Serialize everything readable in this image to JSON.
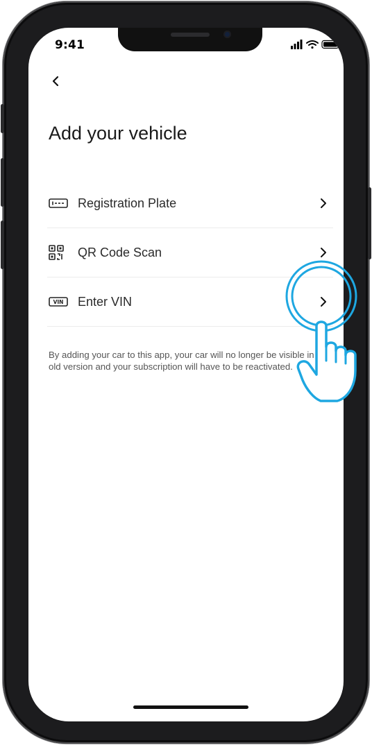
{
  "status_bar": {
    "time": "9:41"
  },
  "header": {
    "back_icon": "chevron-left-icon"
  },
  "page": {
    "title": "Add your vehicle"
  },
  "options": [
    {
      "label": "Registration Plate",
      "icon": "license-plate-icon"
    },
    {
      "label": "QR Code Scan",
      "icon": "qr-code-icon"
    },
    {
      "label": "Enter VIN",
      "icon": "vin-icon",
      "icon_text": "VIN"
    }
  ],
  "disclaimer": "By adding your car to this app, your car will no longer be visible in the old version and your subscription will have to be reactivated.",
  "hint": {
    "icon": "tap-hand-icon",
    "color": "#1ea7e1"
  }
}
